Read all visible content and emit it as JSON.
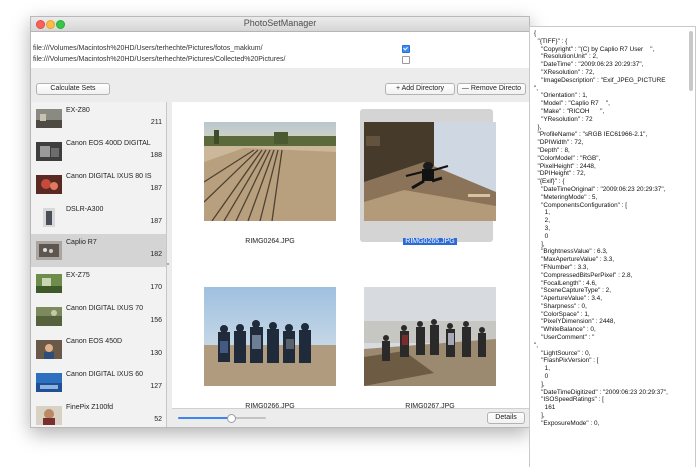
{
  "window": {
    "title": "PhotoSetManager",
    "traffic_lights": {
      "close": "#fc605c",
      "minimize": "#fdbc40",
      "zoom": "#34c749"
    }
  },
  "directories": [
    {
      "path": "file:///Volumes/Macintosh%20HD/Users/terhechte/Pictures/fotos_makkum/",
      "checked": true
    },
    {
      "path": "file:///Volumes/Macintosh%20HD/Users/terhechte/Pictures/Collected%20Pictures/",
      "checked": false
    }
  ],
  "toolbar": {
    "calculate_label": "Calculate Sets",
    "add_label": "+ Add Directory",
    "remove_label": "— Remove Directo"
  },
  "cameras": [
    {
      "name": "EX-Z80",
      "count": "211",
      "icon": "camera-thumb"
    },
    {
      "name": "Canon EOS 400D DIGITAL",
      "count": "188",
      "icon": "camera-thumb"
    },
    {
      "name": "Canon DIGITAL IXUS 80 IS",
      "count": "187",
      "icon": "camera-thumb"
    },
    {
      "name": "DSLR-A300",
      "count": "187",
      "icon": "camera-thumb"
    },
    {
      "name": "Caplio R7",
      "count": "182",
      "icon": "camera-thumb",
      "selected": true
    },
    {
      "name": "EX-Z75",
      "count": "170",
      "icon": "camera-thumb"
    },
    {
      "name": "Canon DIGITAL IXUS 70",
      "count": "156",
      "icon": "camera-thumb"
    },
    {
      "name": "Canon EOS 450D",
      "count": "130",
      "icon": "camera-thumb"
    },
    {
      "name": "Canon DIGITAL IXUS 60",
      "count": "127",
      "icon": "camera-thumb"
    },
    {
      "name": "FinePix Z100fd",
      "count": "52",
      "icon": "camera-thumb"
    }
  ],
  "photos": [
    {
      "name": "RIMG0264.JPG",
      "selected": false
    },
    {
      "name": "RIMG0265.JPG",
      "selected": true
    },
    {
      "name": "RIMG0266.JPG",
      "selected": false
    },
    {
      "name": "RIMG0267.JPG",
      "selected": false
    }
  ],
  "bottom": {
    "zoom_level": 0.6,
    "details_label": "Details"
  },
  "metadata_text": "{\n  \"{TIFF}\" : {\n    \"Copyright\" : \"(C) by Caplio R7 User    \",\n    \"ResolutionUnit\" : 2,\n    \"DateTime\" : \"2009:06:23 20:29:37\",\n    \"XResolution\" : 72,\n    \"ImageDescription\" : \"Exif_JPEG_PICTURE\n\",\n    \"Orientation\" : 1,\n    \"Model\" : \"Caplio R7    \",\n    \"Make\" : \"RICOH      \",\n    \"YResolution\" : 72\n  },\n  \"ProfileName\" : \"sRGB IEC61966-2.1\",\n  \"DPIWidth\" : 72,\n  \"Depth\" : 8,\n  \"ColorModel\" : \"RGB\",\n  \"PixelHeight\" : 2448,\n  \"DPIHeight\" : 72,\n  \"{Exif}\" : {\n    \"DateTimeOriginal\" : \"2009:06:23 20:29:37\",\n    \"MeteringMode\" : 5,\n    \"ComponentsConfiguration\" : [\n      1,\n      2,\n      3,\n      0\n    ],\n    \"BrightnessValue\" : 6.3,\n    \"MaxApertureValue\" : 3.3,\n    \"FNumber\" : 3.3,\n    \"CompressedBitsPerPixel\" : 2.8,\n    \"FocalLength\" : 4.6,\n    \"SceneCaptureType\" : 2,\n    \"ApertureValue\" : 3.4,\n    \"Sharpness\" : 0,\n    \"ColorSpace\" : 1,\n    \"PixelYDimension\" : 2448,\n    \"WhiteBalance\" : 0,\n    \"UserComment\" : \"\n\",\n    \"LightSource\" : 0,\n    \"FlashPixVersion\" : [\n      1,\n      0\n    ],\n    \"DateTimeDigitized\" : \"2009:06:23 20:29:37\",\n    \"ISOSpeedRatings\" : [\n      161\n    ],\n    \"ExposureMode\" : 0,"
}
